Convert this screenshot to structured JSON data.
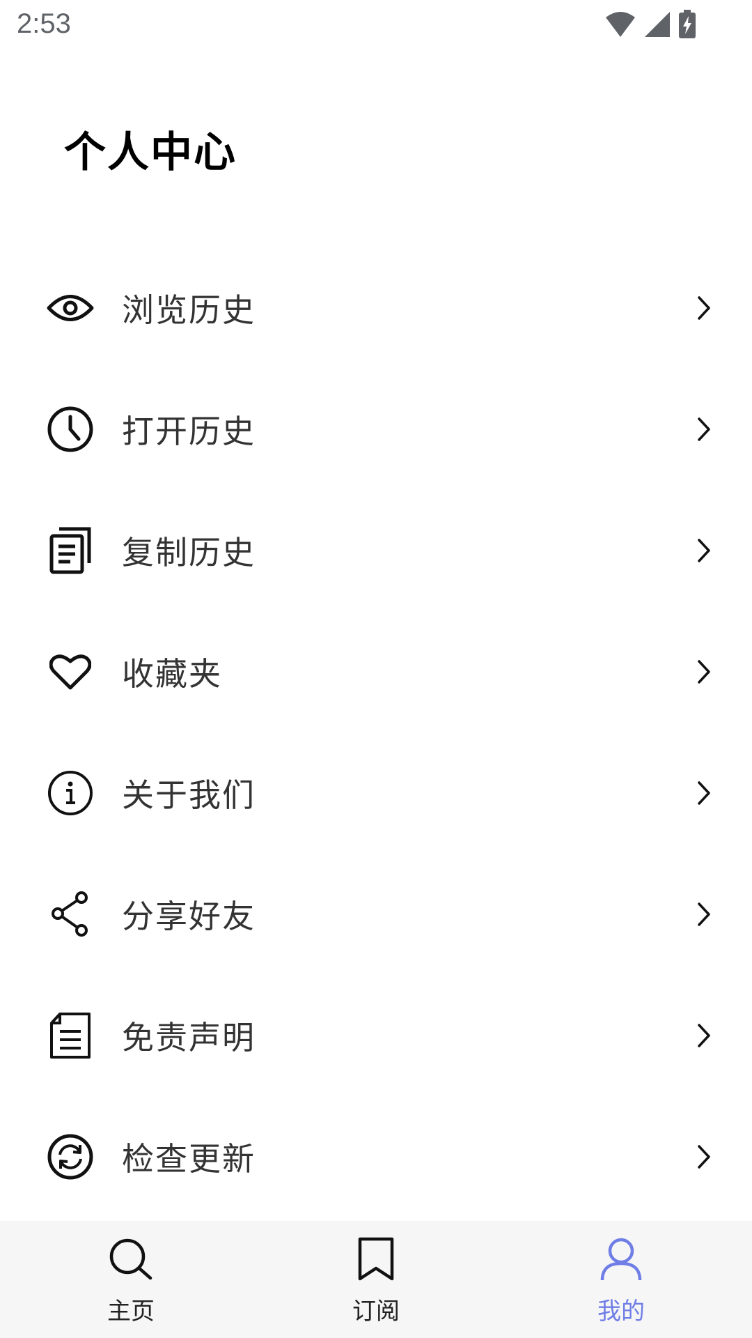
{
  "status_bar": {
    "time": "2:53",
    "icons": [
      "wifi-icon",
      "cellular-signal-icon",
      "battery-charging-icon"
    ]
  },
  "page": {
    "title": "个人中心"
  },
  "menu": {
    "items": [
      {
        "label": "浏览历史",
        "icon": "eye-icon"
      },
      {
        "label": "打开历史",
        "icon": "clock-icon"
      },
      {
        "label": "复制历史",
        "icon": "copy-document-icon"
      },
      {
        "label": "收藏夹",
        "icon": "heart-icon"
      },
      {
        "label": "关于我们",
        "icon": "info-icon"
      },
      {
        "label": "分享好友",
        "icon": "share-icon"
      },
      {
        "label": "免责声明",
        "icon": "document-icon"
      },
      {
        "label": "检查更新",
        "icon": "refresh-icon"
      }
    ]
  },
  "bottom_nav": {
    "items": [
      {
        "label": "主页",
        "icon": "search-icon",
        "active": false
      },
      {
        "label": "订阅",
        "icon": "bookmark-icon",
        "active": false
      },
      {
        "label": "我的",
        "icon": "user-icon",
        "active": true
      }
    ],
    "active_color": "#6f7ee6",
    "background": "#f6f6f6"
  }
}
